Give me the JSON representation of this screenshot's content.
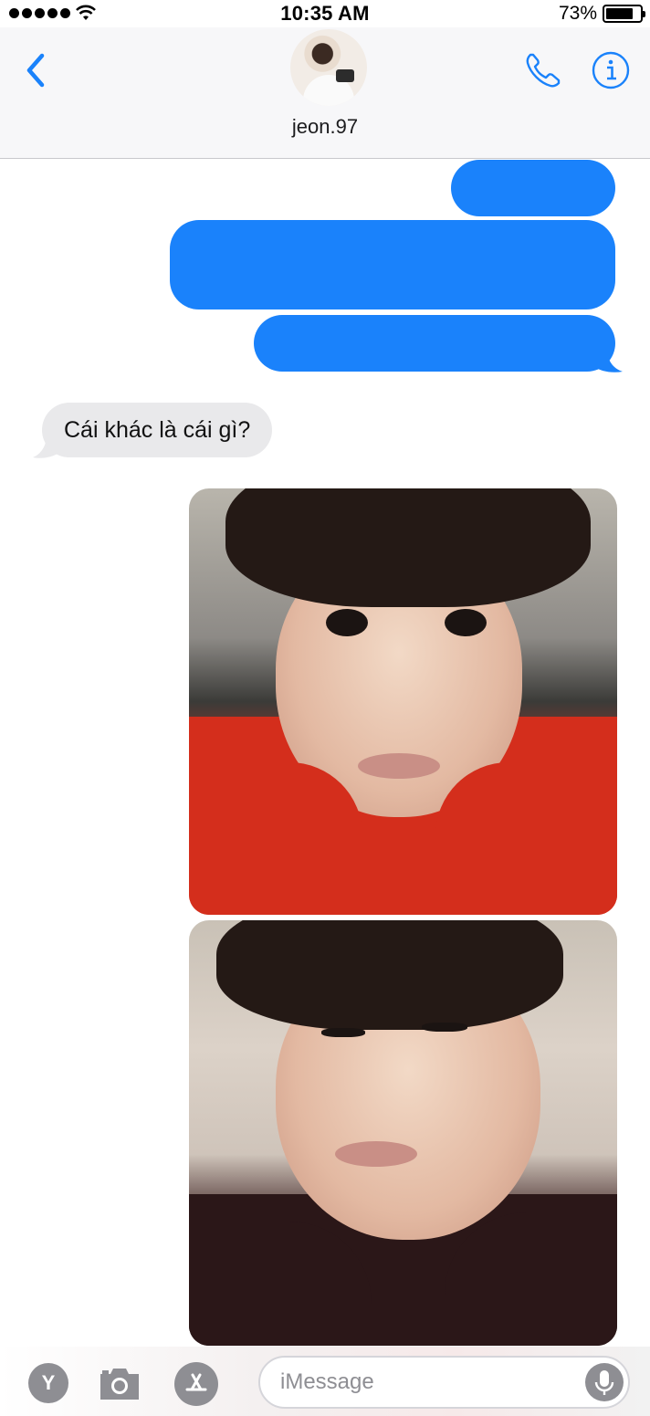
{
  "status_bar": {
    "time": "10:35 AM",
    "battery_percent": "73%",
    "battery_level": 0.73,
    "signal_bars": 5
  },
  "header": {
    "contact_name": "jeon.97",
    "back_icon": "chevron-left-icon",
    "call_icon": "phone-icon",
    "info_icon": "info-icon"
  },
  "messages": {
    "incoming": [
      {
        "text": "Cái khác là cái gì?"
      }
    ],
    "outgoing_redacted_bubbles": 3,
    "outgoing_photos": 2
  },
  "compose": {
    "placeholder": "iMessage",
    "app_button_label": "Y",
    "camera_icon": "camera-icon",
    "appstore_icon": "appstore-icon",
    "mic_icon": "mic-icon"
  },
  "colors": {
    "outgoing_bubble": "#1a82fb",
    "incoming_bubble": "#e9e9eb",
    "accent": "#1a82fb"
  }
}
